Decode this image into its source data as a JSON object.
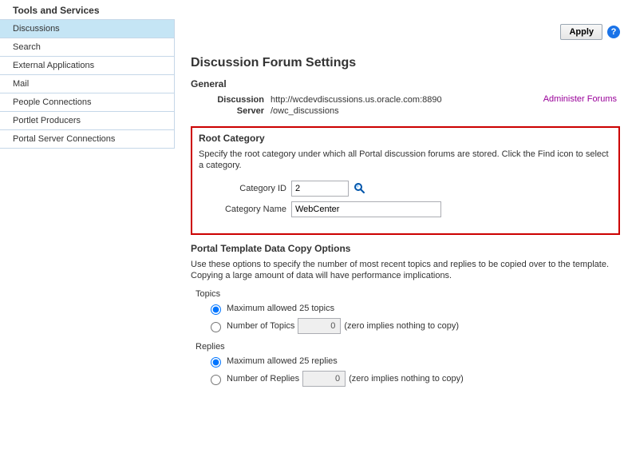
{
  "header": {
    "title": "Tools and Services"
  },
  "sidebar": {
    "items": [
      {
        "label": "Discussions",
        "active": true
      },
      {
        "label": "Search",
        "active": false
      },
      {
        "label": "External Applications",
        "active": false
      },
      {
        "label": "Mail",
        "active": false
      },
      {
        "label": "People Connections",
        "active": false
      },
      {
        "label": "Portlet Producers",
        "active": false
      },
      {
        "label": "Portal Server Connections",
        "active": false
      }
    ]
  },
  "actions": {
    "apply": "Apply"
  },
  "page": {
    "title": "Discussion Forum Settings"
  },
  "general": {
    "heading": "General",
    "server_label": "Discussion Server",
    "server_url": "http://wcdevdiscussions.us.oracle.com:8890",
    "server_path": "/owc_discussions",
    "admin_link": "Administer Forums"
  },
  "root": {
    "heading": "Root Category",
    "desc": "Specify the root category under which all Portal discussion forums are stored. Click the Find icon to select a category.",
    "category_id_label": "Category ID",
    "category_id_value": "2",
    "category_name_label": "Category Name",
    "category_name_value": "WebCenter"
  },
  "template": {
    "heading": "Portal Template Data Copy Options",
    "desc": "Use these options to specify the number of most recent topics and replies to be copied over to the template. Copying a large amount of data will have performance implications.",
    "topics_label": "Topics",
    "topics_max": "Maximum allowed 25 topics",
    "topics_number_label": "Number of Topics",
    "topics_number_value": "0",
    "topics_hint": "(zero implies nothing to copy)",
    "replies_label": "Replies",
    "replies_max": "Maximum allowed 25 replies",
    "replies_number_label": "Number of Replies",
    "replies_number_value": "0",
    "replies_hint": "(zero implies nothing to copy)"
  }
}
